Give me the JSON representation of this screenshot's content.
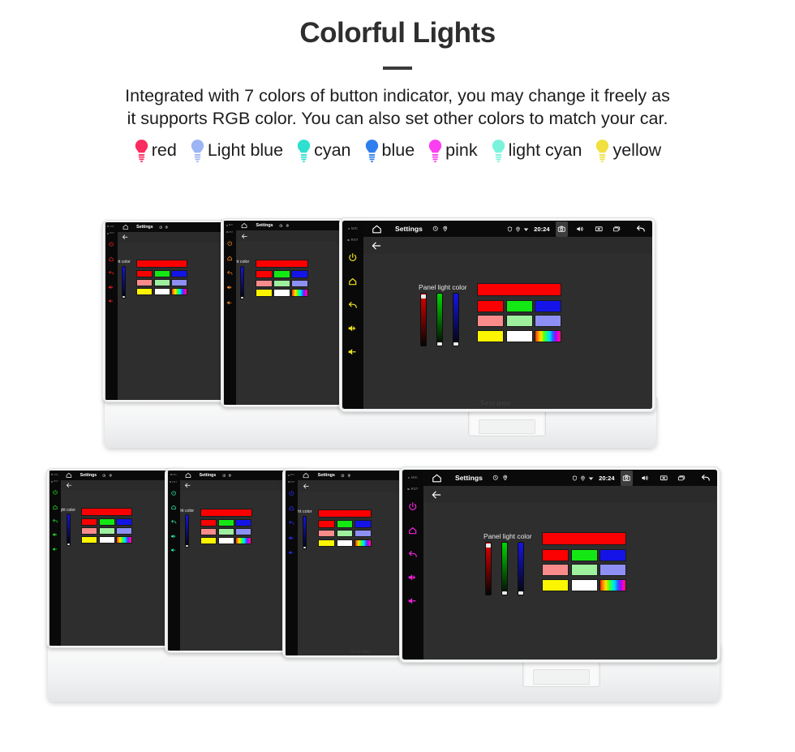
{
  "header": {
    "title": "Colorful Lights",
    "description_line1": "Integrated with 7 colors of button indicator, you may change it freely as",
    "description_line2": "it supports RGB color. You can also set other colors to match your car."
  },
  "legend": {
    "items": [
      {
        "label": "red",
        "color": "#fa2b5e",
        "icon": "bulb-icon"
      },
      {
        "label": "Light blue",
        "color": "#9db4f5",
        "icon": "bulb-icon"
      },
      {
        "label": "cyan",
        "color": "#2fdfd0",
        "icon": "bulb-icon"
      },
      {
        "label": "blue",
        "color": "#2f7eee",
        "icon": "bulb-icon"
      },
      {
        "label": "pink",
        "color": "#fa3ef0",
        "icon": "bulb-icon"
      },
      {
        "label": "light cyan",
        "color": "#7bf2dc",
        "icon": "bulb-icon"
      },
      {
        "label": "yellow",
        "color": "#f0e040",
        "icon": "bulb-icon"
      }
    ]
  },
  "device_screen": {
    "status_bar": {
      "home_icon": "home-icon",
      "title": "Settings",
      "left_icons": [
        "clock-icon",
        "location-icon"
      ],
      "right_icons": [
        "shield-icon",
        "location-pin-icon",
        "wifi-icon"
      ],
      "clock": "20:24",
      "action_icons": [
        "camera-icon",
        "speaker-icon",
        "close-box-icon",
        "recents-icon",
        "back-arrow-icon"
      ],
      "highlighted_icon": "camera-icon"
    },
    "action_bar": {
      "back_icon": "back-arrow-icon"
    },
    "panel": {
      "label": "Panel light color",
      "sliders": [
        {
          "name": "red-slider",
          "color": "#e00000",
          "value": 100
        },
        {
          "name": "green-slider",
          "color": "#00d800",
          "value": 0
        },
        {
          "name": "blue-slider",
          "color": "#1414e6",
          "value": 0
        }
      ],
      "preview_color": "#fb0000",
      "swatches": [
        [
          "#fb0000",
          "#14e814",
          "#1414e8"
        ],
        [
          "#fa8b8b",
          "#9ef09e",
          "#8d90f2"
        ],
        [
          "#fbf500",
          "#ffffff",
          "rainbow"
        ]
      ],
      "rainbow_swatch_name": "rainbow-swatch"
    },
    "brand": "Seicane"
  },
  "rows": [
    {
      "name": "device-row-top",
      "devices": [
        {
          "name": "device-red",
          "key_color": "#e81c1c",
          "detail": "partial"
        },
        {
          "name": "device-orange",
          "key_color": "#f08020",
          "detail": "partial"
        },
        {
          "name": "device-yellow",
          "key_color": "#ece018",
          "detail": "full"
        }
      ]
    },
    {
      "name": "device-row-bottom",
      "devices": [
        {
          "name": "device-green",
          "key_color": "#1fd828",
          "detail": "partial"
        },
        {
          "name": "device-spring-green",
          "key_color": "#24e0a0",
          "detail": "partial"
        },
        {
          "name": "device-blue",
          "key_color": "#2a2af0",
          "detail": "partial"
        },
        {
          "name": "device-magenta",
          "key_color": "#f020d8",
          "detail": "full"
        }
      ]
    }
  ],
  "side_keys": {
    "labels": [
      "MIC",
      "RST"
    ],
    "icons": [
      "power-icon",
      "home-key-icon",
      "back-key-icon",
      "volume-up-icon",
      "volume-down-icon"
    ]
  }
}
